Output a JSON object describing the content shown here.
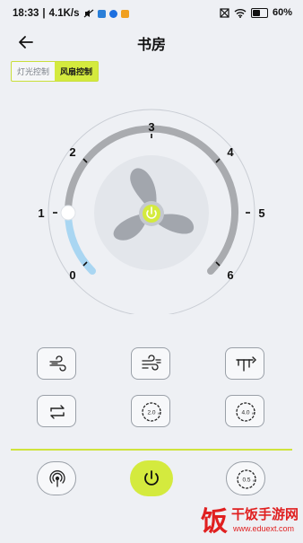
{
  "status_bar": {
    "time": "18:33",
    "speed": "4.1K/s",
    "battery_text": "60%",
    "battery_level": 0.6
  },
  "header": {
    "title": "书房"
  },
  "tabs": [
    {
      "label": "灯光控制",
      "active": false
    },
    {
      "label": "风扇控制",
      "active": true
    }
  ],
  "dial": {
    "levels": [
      "0",
      "1",
      "2",
      "3",
      "4",
      "5",
      "6"
    ],
    "current_level": 1,
    "accent_color": "#d4ea3e",
    "track_color": "#a9abaf",
    "active_color": "#a9d6f2"
  },
  "controls": [
    {
      "name": "wind-mode-1",
      "icon": "wind-icon"
    },
    {
      "name": "wind-mode-2",
      "icon": "wind-strong-icon"
    },
    {
      "name": "oscillate-head",
      "icon": "fan-head-icon"
    },
    {
      "name": "swing",
      "icon": "swing-arrows-icon"
    },
    {
      "name": "timer-2h",
      "icon": "timer-icon",
      "label": "2.0",
      "unit": "H"
    },
    {
      "name": "timer-4h",
      "icon": "timer-icon",
      "label": "4.0",
      "unit": "H"
    }
  ],
  "bottom_bar": {
    "left_icon": "ion-icon",
    "center_icon": "power-icon",
    "right_label": "0.5",
    "right_unit": "H"
  },
  "watermark": {
    "logo_char": "饭",
    "text": "干饭手游网",
    "url": "www.eduext.com"
  }
}
